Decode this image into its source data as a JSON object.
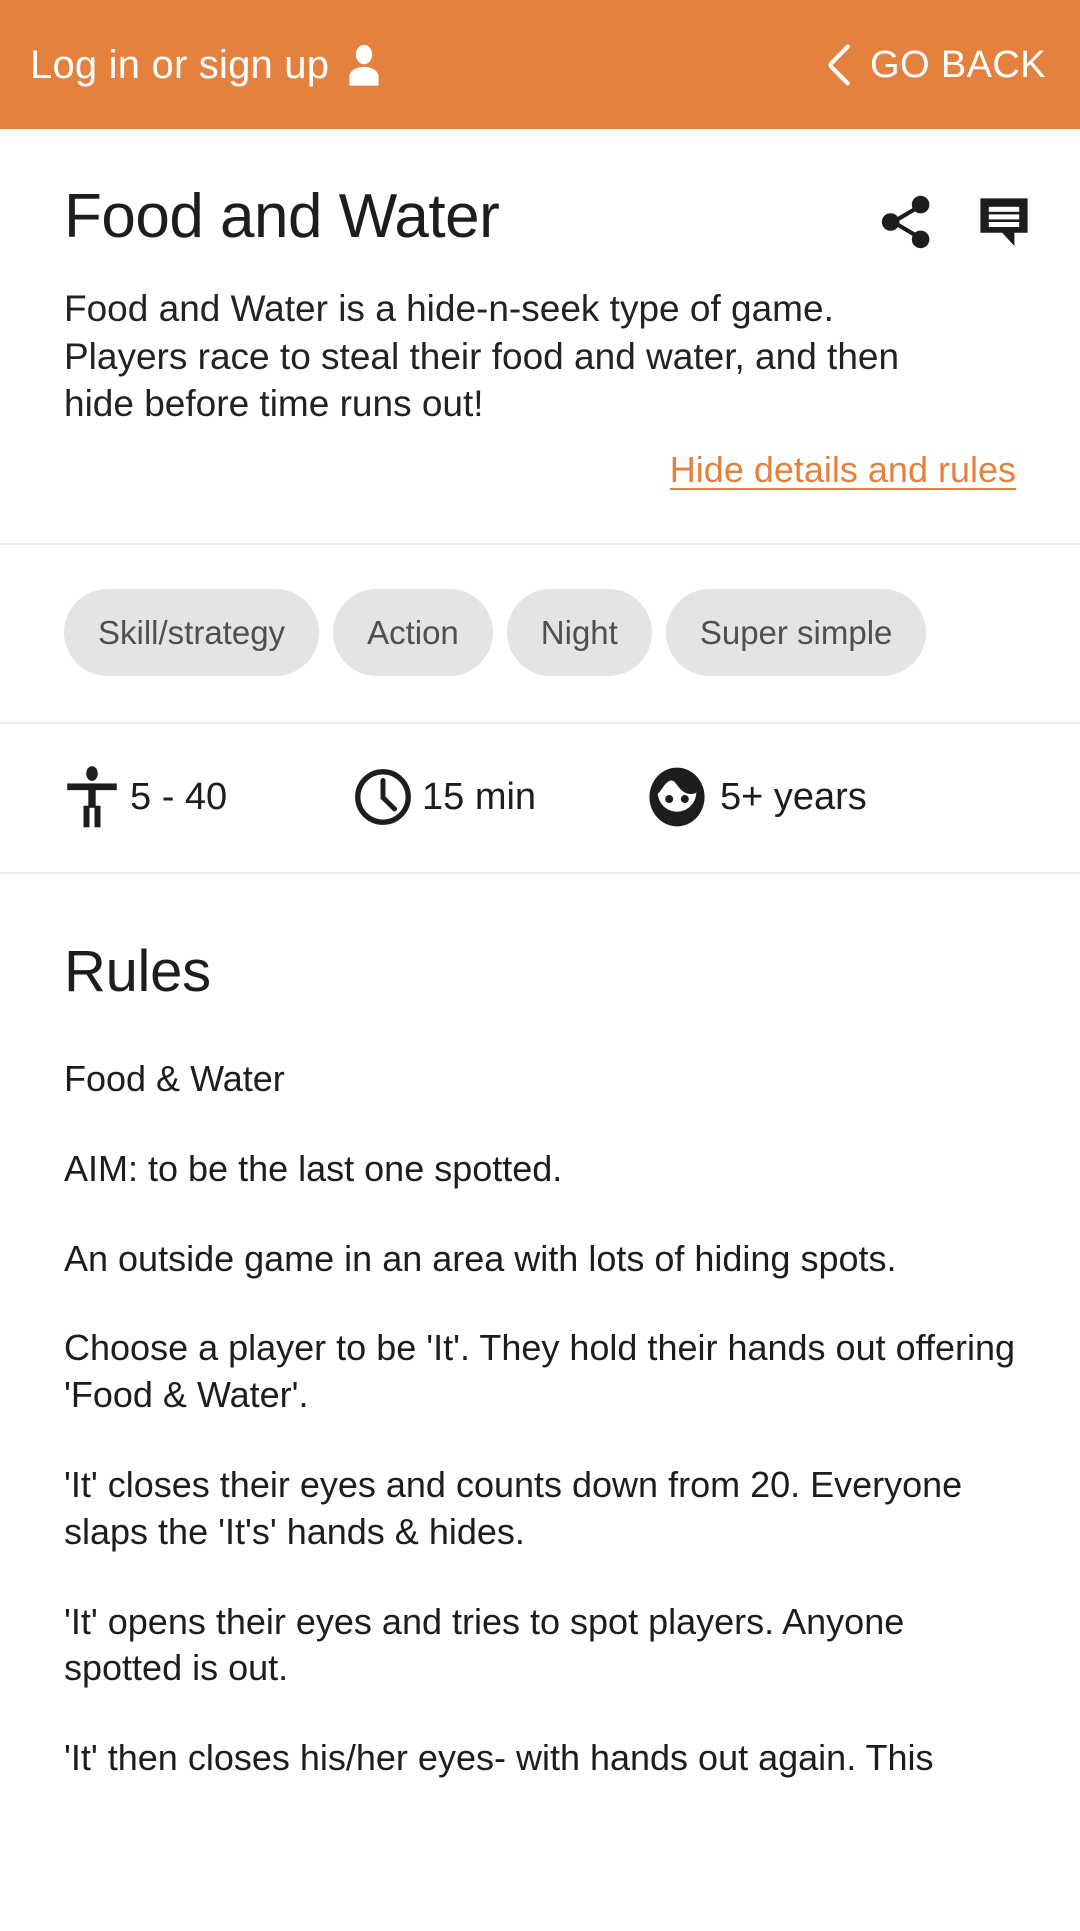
{
  "topbar": {
    "login_label": "Log in or sign up",
    "person_icon": "person-icon",
    "back_label": "GO BACK",
    "chevron_icon": "chevron-left-icon",
    "background_color": "#e4813f",
    "text_color": "#ffffff"
  },
  "header": {
    "title": "Food and Water",
    "share_icon": "share-icon",
    "comment_icon": "comment-icon"
  },
  "description": {
    "text": "Food and Water is a hide-n-seek type of game. Players race to steal their food and water, and then hide before time runs out!",
    "toggle_link": "Hide details and rules",
    "link_color": "#e4813f"
  },
  "tags": [
    {
      "label": "Skill/strategy"
    },
    {
      "label": "Action"
    },
    {
      "label": "Night"
    },
    {
      "label": "Super simple"
    }
  ],
  "meta": {
    "players": {
      "icon": "accessibility-icon",
      "value": "5 - 40"
    },
    "duration": {
      "icon": "clock-icon",
      "value": "15 min"
    },
    "age": {
      "icon": "child-icon",
      "value": "5+ years"
    }
  },
  "rules": {
    "heading": "Rules",
    "paragraphs": [
      "Food & Water",
      "AIM: to be the last one spotted.",
      "An outside game in an area with lots of hiding spots.",
      "Choose a player to be 'It'. They hold their hands out offering 'Food & Water'.",
      "'It' closes their eyes and counts down from 20. Everyone slaps the 'It's' hands & hides.",
      "'It' opens their eyes and tries to spot players. Anyone spotted is out.",
      "'It' then closes his/her eyes- with hands out again. This"
    ]
  }
}
